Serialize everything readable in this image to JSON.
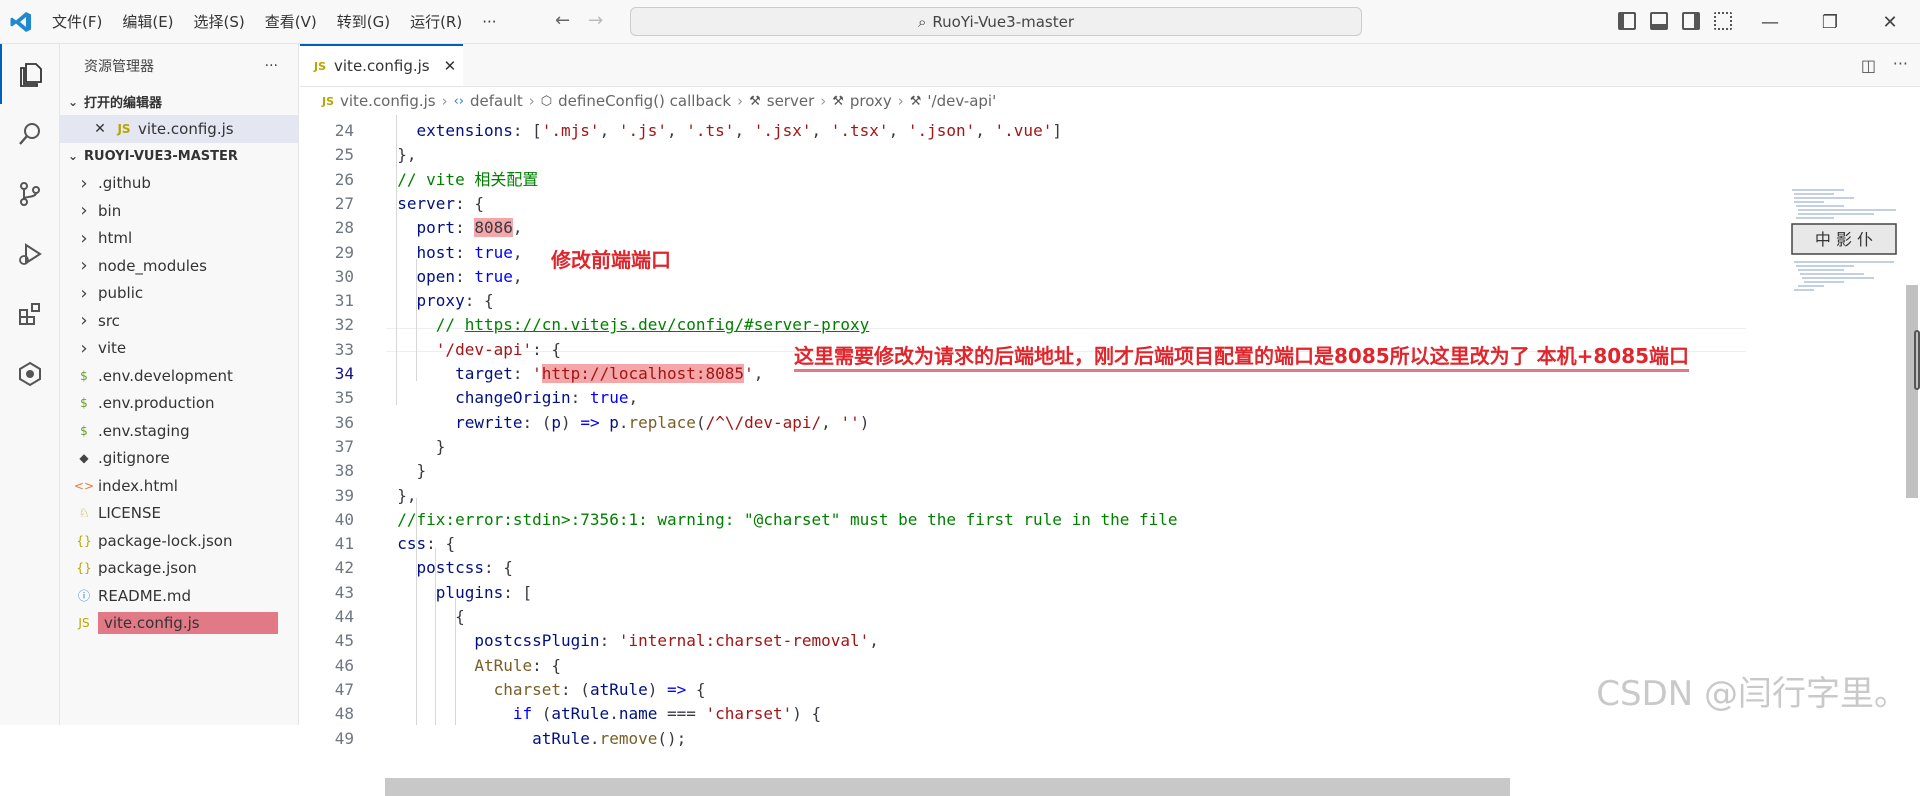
{
  "menu": [
    "文件(F)",
    "编辑(E)",
    "选择(S)",
    "查看(V)",
    "转到(G)",
    "运行(R)",
    "···"
  ],
  "title": "RuoYi-Vue3-master",
  "sidebar": {
    "header": "资源管理器",
    "header_more": "···",
    "open_editors_label": "打开的编辑器",
    "open_editor_file": "vite.config.js",
    "project_label": "RUOYI-VUE3-MASTER",
    "items": [
      {
        "label": ".github",
        "icon": "chevron-right-icon"
      },
      {
        "label": "bin",
        "icon": "chevron-right-icon"
      },
      {
        "label": "html",
        "icon": "chevron-right-icon"
      },
      {
        "label": "node_modules",
        "icon": "chevron-right-icon"
      },
      {
        "label": "public",
        "icon": "chevron-right-icon"
      },
      {
        "label": "src",
        "icon": "chevron-right-icon"
      },
      {
        "label": "vite",
        "icon": "chevron-right-icon"
      },
      {
        "label": ".env.development",
        "icon": "dollar-icon"
      },
      {
        "label": ".env.production",
        "icon": "dollar-icon"
      },
      {
        "label": ".env.staging",
        "icon": "dollar-icon"
      },
      {
        "label": ".gitignore",
        "icon": "git-icon"
      },
      {
        "label": "index.html",
        "icon": "html-icon"
      },
      {
        "label": "LICENSE",
        "icon": "license-icon"
      },
      {
        "label": "package-lock.json",
        "icon": "json-icon"
      },
      {
        "label": "package.json",
        "icon": "json-icon"
      },
      {
        "label": "README.md",
        "icon": "info-icon"
      },
      {
        "label": "vite.config.js",
        "icon": "js-icon"
      }
    ]
  },
  "tab": {
    "label": "vite.config.js",
    "lang": "JS"
  },
  "breadcrumb": [
    "vite.config.js",
    "default",
    "defineConfig() callback",
    "server",
    "proxy",
    "'/dev-api'"
  ],
  "code_lines": [
    {
      "n": "24",
      "html": "    <span class='p'>extensions</span>: [<span class='s'>'.mjs'</span>, <span class='s'>'.js'</span>, <span class='s'>'.ts'</span>, <span class='s'>'.jsx'</span>, <span class='s'>'.tsx'</span>, <span class='s'>'.json'</span>, <span class='s'>'.vue'</span>]"
    },
    {
      "n": "25",
      "html": "  },"
    },
    {
      "n": "26",
      "html": "  <span class='c'>// vite 相关配置</span>"
    },
    {
      "n": "27",
      "html": "  <span class='p'>server</span>: {"
    },
    {
      "n": "28",
      "html": "    <span class='p'>port</span>: <span class='hl'>8086</span>,"
    },
    {
      "n": "29",
      "html": "    <span class='p'>host</span>: <span class='k'>true</span>,"
    },
    {
      "n": "30",
      "html": "    <span class='p'>open</span>: <span class='k'>true</span>,"
    },
    {
      "n": "31",
      "html": "    <span class='p'>proxy</span>: {"
    },
    {
      "n": "32",
      "html": "      <span class='c'>// </span><span class='u'>https://cn.vitejs.dev/config/#server-proxy</span>"
    },
    {
      "n": "33",
      "html": "      <span class='s'>'/dev-api'</span>: {"
    },
    {
      "n": "34",
      "html": "        <span class='p'>target</span>: <span class='s'>'<span class='hl'>http://localhost:8085</span>'</span>,"
    },
    {
      "n": "35",
      "html": "        <span class='p'>changeOrigin</span>: <span class='k'>true</span>,"
    },
    {
      "n": "36",
      "html": "        <span class='p'>rewrite</span>: (<span class='p'>p</span>) <span class='k'>=&gt;</span> <span class='p'>p</span>.<span class='f'>replace</span>(<span class='s'>/^\\/dev-api/</span>, <span class='s'>''</span>)"
    },
    {
      "n": "37",
      "html": "      }"
    },
    {
      "n": "38",
      "html": "    }"
    },
    {
      "n": "39",
      "html": "  },"
    },
    {
      "n": "40",
      "html": "  <span class='c'>//fix:error:stdin&gt;:7356:1: warning: \"@charset\" must be the first rule in the file</span>"
    },
    {
      "n": "41",
      "html": "  <span class='p'>css</span>: {"
    },
    {
      "n": "42",
      "html": "    <span class='p'>postcss</span>: {"
    },
    {
      "n": "43",
      "html": "      <span class='p'>plugins</span>: ["
    },
    {
      "n": "44",
      "html": "        {"
    },
    {
      "n": "45",
      "html": "          <span class='p'>postcssPlugin</span>: <span class='s'>'internal:charset-removal'</span>,"
    },
    {
      "n": "46",
      "html": "          <span class='f'>AtRule</span>: {"
    },
    {
      "n": "47",
      "html": "            <span class='f'>charset</span>: (<span class='p'>atRule</span>) <span class='k'>=&gt;</span> {"
    },
    {
      "n": "48",
      "html": "              <span class='k'>if</span> (<span class='p'>atRule</span>.<span class='p'>name</span> === <span class='s'>'charset'</span>) {"
    },
    {
      "n": "49",
      "html": "                <span class='p'>atRule</span>.<span class='f'>remove</span>();"
    }
  ],
  "annotations": {
    "port_note": "修改前端端口",
    "target_note": "这里需要修改为请求的后端地址，刚才后端项目配置的端口是8085所以这里改为了  本机+8085端口"
  },
  "watermark": "CSDN @闫行字里。",
  "minimap_stamp": "中 影 仆",
  "colors": {
    "accent": "#005fb8",
    "annotation": "#e0262c",
    "highlight": "#f4a6a8"
  }
}
